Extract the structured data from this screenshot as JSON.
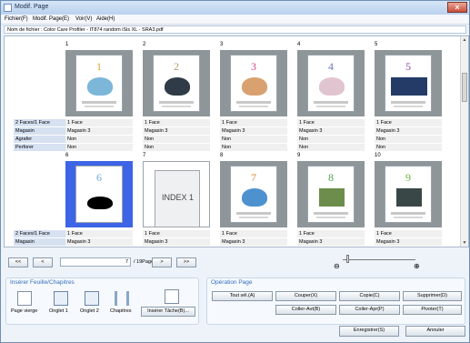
{
  "window": {
    "title": "Modif. Page",
    "close_icon": "×"
  },
  "menus": [
    "Fichier(F)",
    "Modif. Page(E)",
    "Voir(V)",
    "Aide(H)"
  ],
  "file": {
    "label": "Nom de fichier : Color Care Profiler - IT874 random iSis XL - SRA3.pdf"
  },
  "properties": {
    "row_labels": [
      "2 Faces/1 Face",
      "Magasin",
      "Agrafer",
      "Perforer"
    ],
    "values": [
      "1 Face",
      "Magasin 3",
      "Non",
      "Non"
    ]
  },
  "pages": [
    {
      "number": "1",
      "digit": "1",
      "digit_color": "#d9a33b",
      "art_color": "#7cb6d9"
    },
    {
      "number": "2",
      "digit": "2",
      "digit_color": "#b99a6a",
      "art_color": "#2f3b46"
    },
    {
      "number": "3",
      "digit": "3",
      "digit_color": "#d14a87",
      "art_color": "#d8a16f"
    },
    {
      "number": "4",
      "digit": "4",
      "digit_color": "#6e79c0",
      "art_color": "#e0c4cf"
    },
    {
      "number": "5",
      "digit": "5",
      "digit_color": "#8d4a9b",
      "art_color": "#243b67"
    },
    {
      "number": "6",
      "digit": "6",
      "digit_color": "#71a8d9",
      "art_color": "#000000"
    },
    {
      "number": "7",
      "digit": "",
      "digit_color": "#000000",
      "art_color": "#000000"
    },
    {
      "number": "8",
      "digit": "7",
      "digit_color": "#d88632",
      "art_color": "#4d91cf"
    },
    {
      "number": "9",
      "digit": "8",
      "digit_color": "#4ba24d",
      "art_color": "#6c8d4c"
    },
    {
      "number": "10",
      "digit": "9",
      "digit_color": "#68b845",
      "art_color": "#394747"
    }
  ],
  "index_page": {
    "text": "INDEX 1"
  },
  "navigation": {
    "first": "<<",
    "prev": "<",
    "current": "7",
    "total": "/ 19Page",
    "next": ">",
    "last": ">>"
  },
  "zoom": {
    "minus": "⊖",
    "plus": "⊕",
    "level_percent": 5
  },
  "insert": {
    "title": "Insérer Feuille/Chapitres",
    "tools": [
      "Page vierge",
      "Onglet 1",
      "Onglet 2",
      "Chapitres"
    ],
    "insert_button": "Insérer Tâche(B)..."
  },
  "operations": {
    "title": "Opération Page",
    "buttons": [
      "Tout sél.(A)",
      "Couper(X)",
      "Copie(C)",
      "Supprimer(D)",
      "Coller-Avt(B)",
      "Coller-Apr(P)",
      "Pivoter(T)"
    ]
  },
  "footer": {
    "save": "Enregistrer(S)",
    "cancel": "Annuler"
  },
  "colors": {
    "selected_frame": "#3d64e7",
    "accent": "#366fbe"
  }
}
